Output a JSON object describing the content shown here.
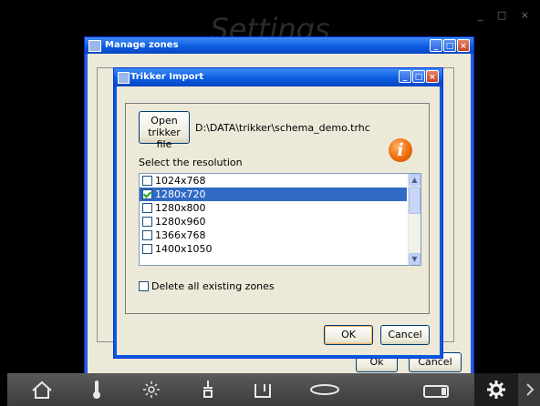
{
  "background": {
    "title": "Settings",
    "window_controls": "_ □ ×"
  },
  "manage_zones": {
    "title": "Manage zones",
    "ok_label": "Ok",
    "cancel_label": "Cancel"
  },
  "trikker_import": {
    "title": "Trikker Import",
    "open_button_label_line1": "Open",
    "open_button_label_line2": "trikker file",
    "file_path": "D:\\DATA\\trikker\\schema_demo.trhc",
    "resolution_label": "Select the resolution",
    "resolutions": [
      {
        "label": "1024x768",
        "checked": false,
        "selected": false
      },
      {
        "label": "1280x720",
        "checked": true,
        "selected": true
      },
      {
        "label": "1280x800",
        "checked": false,
        "selected": false
      },
      {
        "label": "1280x960",
        "checked": false,
        "selected": false
      },
      {
        "label": "1366x768",
        "checked": false,
        "selected": false
      },
      {
        "label": "1400x1050",
        "checked": false,
        "selected": false
      }
    ],
    "delete_label": "Delete all existing zones",
    "delete_checked": false,
    "ok_label": "OK",
    "cancel_label": "Cancel"
  },
  "toolbar": {
    "icons": [
      "home-icon",
      "temperature-icon",
      "light-icon",
      "blind-icon",
      "door-icon",
      "oval-icon",
      "screen-icon",
      "gear-icon",
      "chevron-right-icon"
    ]
  },
  "colors": {
    "title_bar": "#0a5ae0",
    "selection": "#316ac5",
    "window_bg": "#ece9d8",
    "info_orange": "#ee6d0c"
  }
}
